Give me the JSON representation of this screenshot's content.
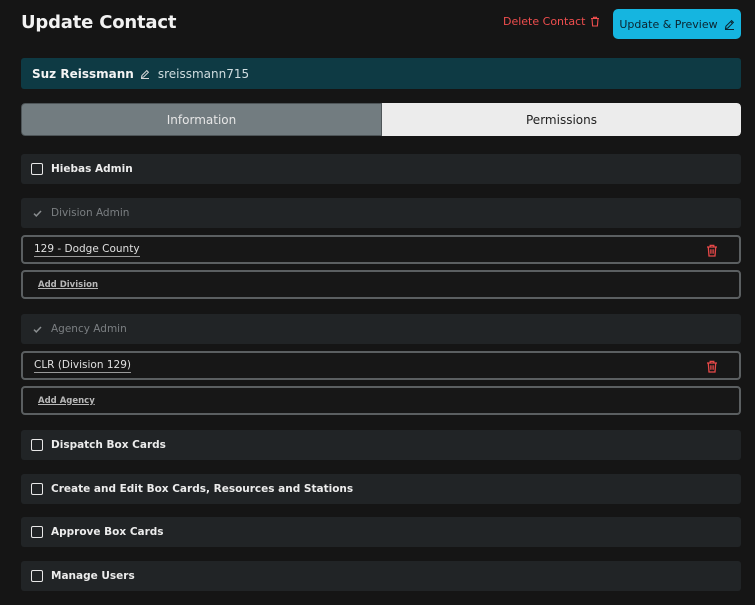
{
  "header": {
    "title": "Update Contact",
    "delete_label": "Delete Contact",
    "update_label": "Update & Preview"
  },
  "contact": {
    "full_name": "Suz Reissmann",
    "username": "sreissmann715"
  },
  "tabs": [
    {
      "label": "Information",
      "active": false
    },
    {
      "label": "Permissions",
      "active": true
    }
  ],
  "permissions": {
    "hiebas_admin": {
      "label": "Hiebas Admin",
      "checked": false
    },
    "division_admin": {
      "label": "Division Admin",
      "checked": true
    },
    "division_entry": {
      "label": "129 - Dodge County"
    },
    "add_division": "Add Division",
    "agency_admin": {
      "label": "Agency Admin",
      "checked": true
    },
    "agency_entry": {
      "label": "CLR (Division 129)"
    },
    "add_agency": "Add Agency",
    "dispatch": {
      "label": "Dispatch Box Cards",
      "checked": false
    },
    "create_edit": {
      "label": "Create and Edit Box Cards, Resources and Stations",
      "checked": false
    },
    "approve": {
      "label": "Approve Box Cards",
      "checked": false
    },
    "manage_users": {
      "label": "Manage Users",
      "checked": false
    }
  },
  "colors": {
    "accent": "#15b5e0",
    "danger": "#ef4e4e",
    "name_bar": "#0e3a44",
    "background": "#151515"
  }
}
